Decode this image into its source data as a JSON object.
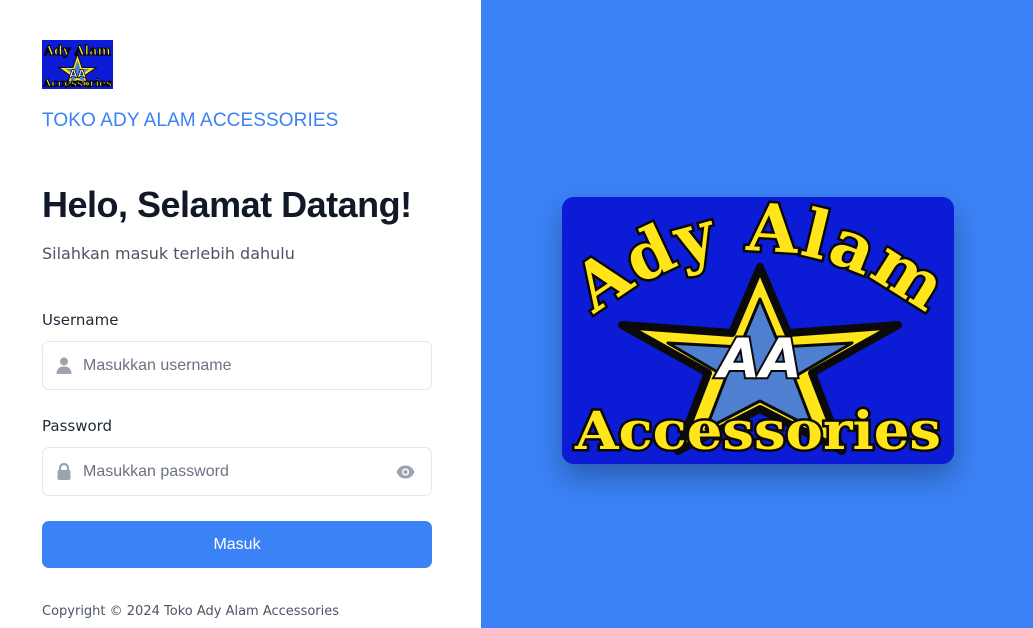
{
  "brand": {
    "name": "TOKO ADY ALAM ACCESSORIES",
    "logo_top_text": "Ady Alam",
    "logo_mid_text": "AA",
    "logo_bottom_text": "Accessories"
  },
  "heading": {
    "title": "Helo, Selamat Datang!",
    "subtitle": "Silahkan masuk terlebih dahulu"
  },
  "form": {
    "username_label": "Username",
    "username_placeholder": "Masukkan username",
    "username_value": "",
    "password_label": "Password",
    "password_placeholder": "Masukkan password",
    "password_value": "",
    "submit_label": "Masuk"
  },
  "footer": {
    "copyright": "Copyright © 2024 Toko Ady Alam Accessories"
  },
  "icons": {
    "username": "user-icon",
    "password": "lock-icon",
    "toggle": "eye-icon"
  },
  "colors": {
    "accent": "#3b82f6",
    "logo_bg": "#0c1bd6",
    "logo_yellow": "#ffe51a"
  }
}
